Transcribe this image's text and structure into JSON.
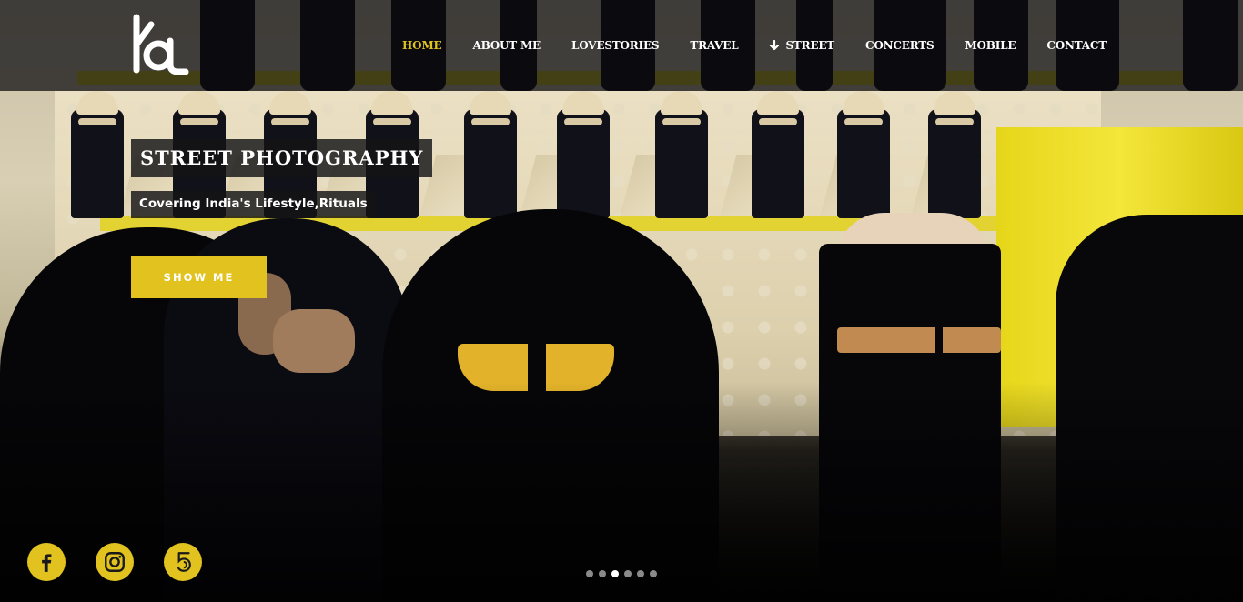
{
  "brand": {
    "logo_icon": "kd-monogram-icon"
  },
  "nav": {
    "items": [
      {
        "label": "HOME",
        "active": true
      },
      {
        "label": "ABOUT ME",
        "active": false
      },
      {
        "label": "LOVESTORIES",
        "active": false
      },
      {
        "label": "TRAVEL",
        "active": false
      },
      {
        "label": "STREET",
        "active": false,
        "icon": "arrow-down-icon"
      },
      {
        "label": "CONCERTS",
        "active": false
      },
      {
        "label": "MOBILE",
        "active": false
      },
      {
        "label": "CONTACT",
        "active": false
      }
    ]
  },
  "slide": {
    "title": "STREET PHOTOGRAPHY",
    "subtitle": "Covering India's Lifestyle,Rituals",
    "button_label": "SHOW ME"
  },
  "social": [
    {
      "name": "facebook-icon"
    },
    {
      "name": "instagram-icon"
    },
    {
      "name": "500px-icon"
    }
  ],
  "slider": {
    "count": 6,
    "active_index": 2
  },
  "colors": {
    "accent": "#e1c21f",
    "header_bg": "#0a0a0e",
    "text": "#ffffff"
  }
}
